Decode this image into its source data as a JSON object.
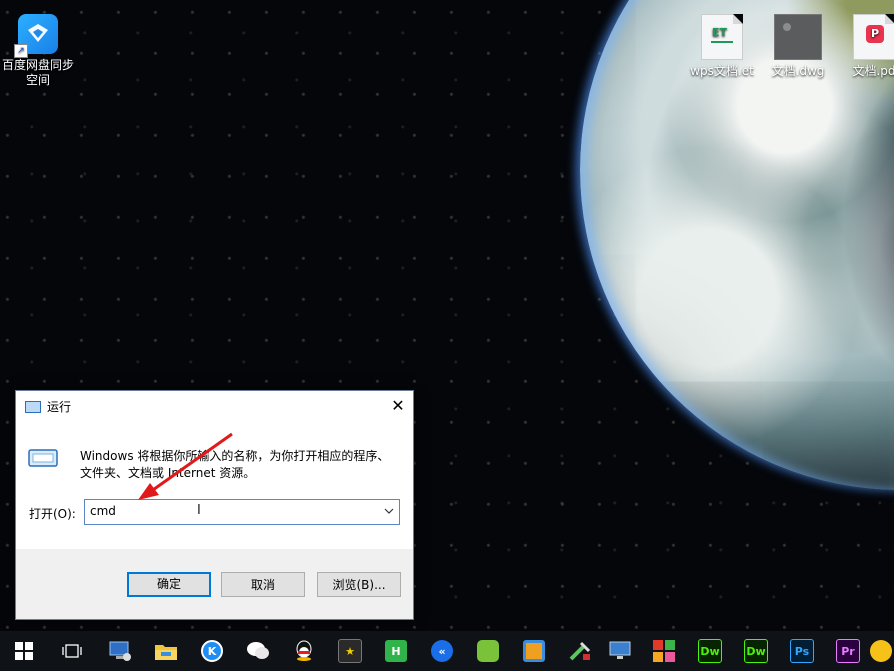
{
  "desktop": {
    "icons": [
      {
        "label_line1": "百度网盘同步",
        "label_line2": "空间",
        "icon": "baidu-netdisk-sync-icon"
      },
      {
        "label": "wps文档.et",
        "icon": "wps-et-file-icon",
        "badge": "ET"
      },
      {
        "label": "文档.dwg",
        "icon": "dwg-file-icon"
      },
      {
        "label": "文档.pd",
        "icon": "pdf-file-icon"
      }
    ]
  },
  "run_dialog": {
    "title": "运行",
    "close_glyph": "✕",
    "description_line1": "Windows 将根据你所输入的名称，为你打开相应的程序、",
    "description_line2": "文件夹、文档或 Internet 资源。",
    "open_label": "打开(O):",
    "open_value": "cmd",
    "buttons": {
      "ok": "确定",
      "cancel": "取消",
      "browse": "浏览(B)..."
    }
  },
  "taskbar": {
    "items": [
      {
        "name": "start-button",
        "icon": "windows-logo-icon"
      },
      {
        "name": "task-view-button",
        "icon": "task-view-icon"
      },
      {
        "name": "this-pc",
        "icon": "computer-icon"
      },
      {
        "name": "file-explorer",
        "icon": "folder-icon"
      },
      {
        "name": "kugou",
        "icon": "kugou-icon",
        "glyph": "K"
      },
      {
        "name": "wechat",
        "icon": "wechat-icon"
      },
      {
        "name": "qq",
        "icon": "qq-icon"
      },
      {
        "name": "app-star",
        "icon": "star-app-icon"
      },
      {
        "name": "hbuilder",
        "icon": "hbuilder-icon",
        "glyph": "H"
      },
      {
        "name": "app-k-blue",
        "icon": "k-blue-app-icon"
      },
      {
        "name": "app-green",
        "icon": "green-app-icon"
      },
      {
        "name": "app-orange",
        "icon": "orange-app-icon"
      },
      {
        "name": "app-tools",
        "icon": "tools-app-icon"
      },
      {
        "name": "remote-desktop",
        "icon": "monitor-icon"
      },
      {
        "name": "app-colorblocks",
        "icon": "color-blocks-icon"
      },
      {
        "name": "dreamweaver-1",
        "icon": "dreamweaver-icon",
        "glyph": "Dw"
      },
      {
        "name": "dreamweaver-2",
        "icon": "dreamweaver-icon",
        "glyph": "Dw"
      },
      {
        "name": "photoshop",
        "icon": "photoshop-icon",
        "glyph": "Ps"
      },
      {
        "name": "premiere",
        "icon": "premiere-icon",
        "glyph": "Pr"
      },
      {
        "name": "app-yellow",
        "icon": "yellow-app-icon"
      }
    ]
  },
  "colors": {
    "accent": "#0078d7",
    "arrow": "#e0191a",
    "dialog_bg": "#f0f0f0"
  }
}
